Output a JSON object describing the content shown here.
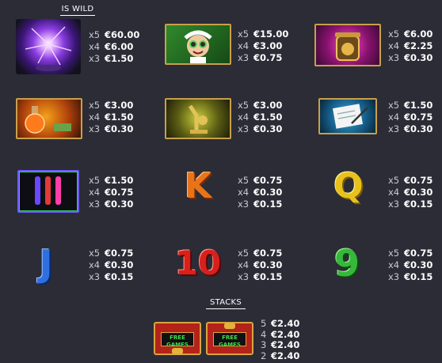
{
  "headings": {
    "wild": "IS WILD",
    "stacks": "STACKS"
  },
  "symbols": [
    {
      "name": "plasma-ball",
      "pays": [
        {
          "m": "x5",
          "v": "€60.00"
        },
        {
          "m": "x4",
          "v": "€6.00"
        },
        {
          "m": "x3",
          "v": "€1.50"
        }
      ]
    },
    {
      "name": "mad-scientist",
      "pays": [
        {
          "m": "x5",
          "v": "€15.00"
        },
        {
          "m": "x4",
          "v": "€3.00"
        },
        {
          "m": "x3",
          "v": "€0.75"
        }
      ]
    },
    {
      "name": "money-jar",
      "pays": [
        {
          "m": "x5",
          "v": "€6.00"
        },
        {
          "m": "x4",
          "v": "€2.25"
        },
        {
          "m": "x3",
          "v": "€0.30"
        }
      ]
    },
    {
      "name": "potion-flask",
      "pays": [
        {
          "m": "x5",
          "v": "€3.00"
        },
        {
          "m": "x4",
          "v": "€1.50"
        },
        {
          "m": "x3",
          "v": "€0.30"
        }
      ]
    },
    {
      "name": "microscope",
      "pays": [
        {
          "m": "x5",
          "v": "€3.00"
        },
        {
          "m": "x4",
          "v": "€1.50"
        },
        {
          "m": "x3",
          "v": "€0.30"
        }
      ]
    },
    {
      "name": "notepad",
      "pays": [
        {
          "m": "x5",
          "v": "€1.50"
        },
        {
          "m": "x4",
          "v": "€0.75"
        },
        {
          "m": "x3",
          "v": "€0.30"
        }
      ]
    },
    {
      "name": "test-tubes",
      "pays": [
        {
          "m": "x5",
          "v": "€1.50"
        },
        {
          "m": "x4",
          "v": "€0.75"
        },
        {
          "m": "x3",
          "v": "€0.30"
        }
      ]
    },
    {
      "name": "letter-k",
      "label": "K",
      "pays": [
        {
          "m": "x5",
          "v": "€0.75"
        },
        {
          "m": "x4",
          "v": "€0.30"
        },
        {
          "m": "x3",
          "v": "€0.15"
        }
      ]
    },
    {
      "name": "letter-q",
      "label": "Q",
      "pays": [
        {
          "m": "x5",
          "v": "€0.75"
        },
        {
          "m": "x4",
          "v": "€0.30"
        },
        {
          "m": "x3",
          "v": "€0.15"
        }
      ]
    },
    {
      "name": "letter-j",
      "label": "J",
      "pays": [
        {
          "m": "x5",
          "v": "€0.75"
        },
        {
          "m": "x4",
          "v": "€0.30"
        },
        {
          "m": "x3",
          "v": "€0.15"
        }
      ]
    },
    {
      "name": "number-10",
      "label": "10",
      "pays": [
        {
          "m": "x5",
          "v": "€0.75"
        },
        {
          "m": "x4",
          "v": "€0.30"
        },
        {
          "m": "x3",
          "v": "€0.15"
        }
      ]
    },
    {
      "name": "number-9",
      "label": "9",
      "pays": [
        {
          "m": "x5",
          "v": "€0.75"
        },
        {
          "m": "x4",
          "v": "€0.30"
        },
        {
          "m": "x3",
          "v": "€0.15"
        }
      ]
    }
  ],
  "stacks": {
    "free_games_label_1": "FREE",
    "free_games_label_2": "GAMES",
    "pays": [
      {
        "n": "5",
        "v": "€2.40"
      },
      {
        "n": "4",
        "v": "€2.40"
      },
      {
        "n": "3",
        "v": "€2.40"
      },
      {
        "n": "2",
        "v": "€2.40"
      }
    ]
  },
  "colors": {
    "background": "#2b2c36",
    "tile_border": "#c9a04a",
    "letter_k": "#e8741a",
    "letter_q": "#e8c21a",
    "letter_j": "#2f6fe0",
    "number_10": "#d8201c",
    "number_9": "#36b83a"
  }
}
